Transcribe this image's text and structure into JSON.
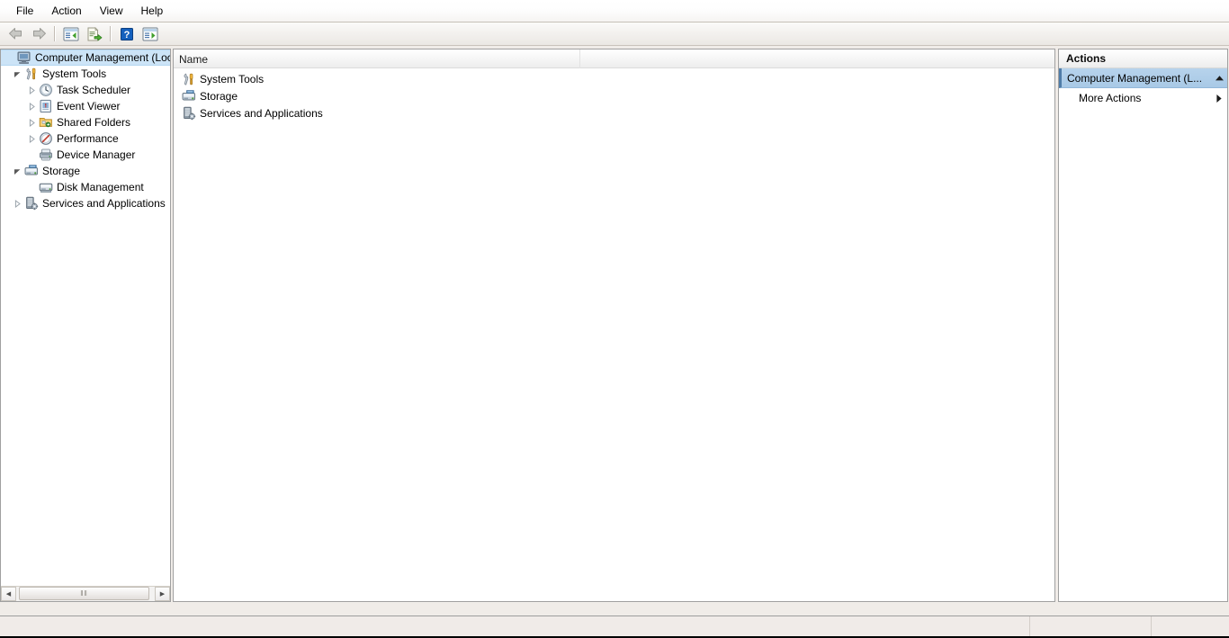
{
  "window": {
    "title": "Computer Management"
  },
  "menubar": {
    "items": [
      {
        "label": "File",
        "name": "menu-file"
      },
      {
        "label": "Action",
        "name": "menu-action"
      },
      {
        "label": "View",
        "name": "menu-view"
      },
      {
        "label": "Help",
        "name": "menu-help"
      }
    ]
  },
  "toolbar": {
    "buttons": [
      {
        "icon": "back-arrow-icon",
        "title": "Back"
      },
      {
        "icon": "forward-arrow-icon",
        "title": "Forward"
      },
      {
        "icon": "show-hide-console-tree-icon",
        "title": "Show/Hide Console Tree"
      },
      {
        "icon": "export-list-icon",
        "title": "Export List"
      },
      {
        "icon": "help-icon",
        "title": "Help"
      },
      {
        "icon": "show-hide-action-pane-icon",
        "title": "Show/Hide Action Pane"
      }
    ]
  },
  "tree": {
    "items": [
      {
        "label": "Computer Management (Local",
        "icon": "computer-icon",
        "indent": 0,
        "twisty": "none",
        "selected": true
      },
      {
        "label": "System Tools",
        "icon": "system-tools-icon",
        "indent": 1,
        "twisty": "expanded",
        "selected": false
      },
      {
        "label": "Task Scheduler",
        "icon": "clock-icon",
        "indent": 2,
        "twisty": "collapsed",
        "selected": false
      },
      {
        "label": "Event Viewer",
        "icon": "event-viewer-icon",
        "indent": 2,
        "twisty": "collapsed",
        "selected": false
      },
      {
        "label": "Shared Folders",
        "icon": "shared-folders-icon",
        "indent": 2,
        "twisty": "collapsed",
        "selected": false
      },
      {
        "label": "Performance",
        "icon": "performance-icon",
        "indent": 2,
        "twisty": "collapsed",
        "selected": false
      },
      {
        "label": "Device Manager",
        "icon": "device-manager-icon",
        "indent": 2,
        "twisty": "none",
        "selected": false
      },
      {
        "label": "Storage",
        "icon": "storage-icon",
        "indent": 1,
        "twisty": "expanded",
        "selected": false
      },
      {
        "label": "Disk Management",
        "icon": "disk-management-icon",
        "indent": 2,
        "twisty": "none",
        "selected": false
      },
      {
        "label": "Services and Applications",
        "icon": "services-icon",
        "indent": 1,
        "twisty": "collapsed",
        "selected": false
      }
    ],
    "scrollbar": {
      "left_arrow": "◀",
      "right_arrow": "▶",
      "grip": "‖‖"
    }
  },
  "list": {
    "columns": [
      "Name",
      ""
    ],
    "rows": [
      {
        "name": "System Tools",
        "icon": "system-tools-icon"
      },
      {
        "name": "Storage",
        "icon": "storage-icon"
      },
      {
        "name": "Services and Applications",
        "icon": "services-icon"
      }
    ]
  },
  "actions": {
    "title": "Actions",
    "group_header": {
      "label": "Computer Management (L...",
      "chevron": "▲"
    },
    "items": [
      {
        "label": "More Actions",
        "arrow": "▶"
      }
    ]
  },
  "statusbar": {
    "cells": [
      "",
      "",
      ""
    ]
  },
  "colors": {
    "selection": "#cce4f7",
    "actions_header": "#a8c9e6",
    "accent_bar": "#4f7ca8",
    "pane_border": "#a0a0a0",
    "chrome_bg": "#f0ece8"
  }
}
